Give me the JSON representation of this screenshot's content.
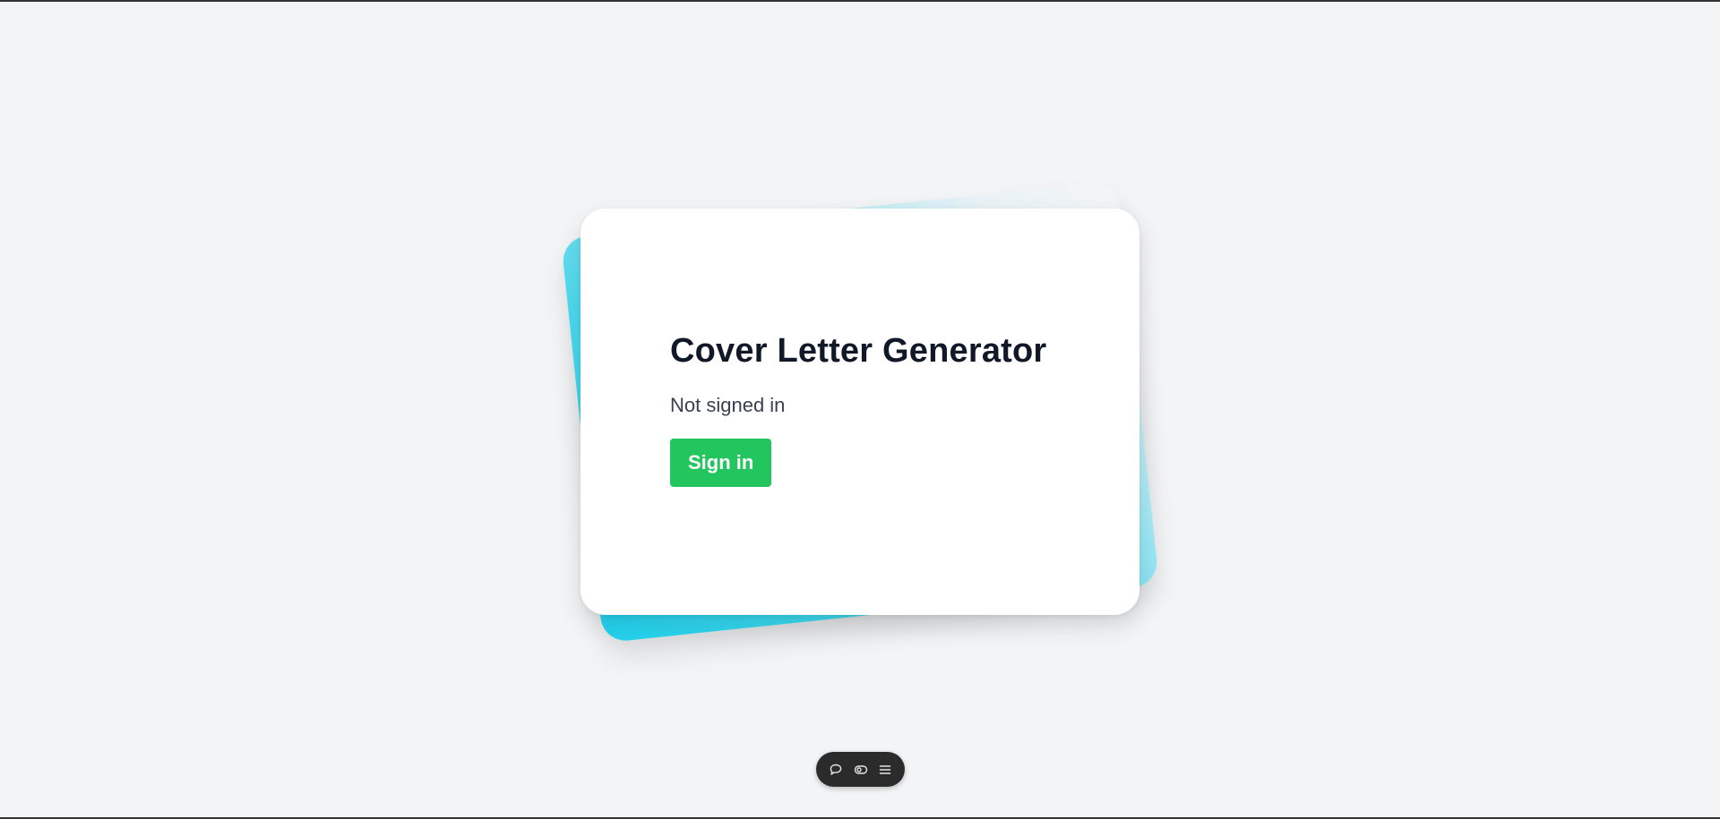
{
  "card": {
    "title": "Cover Letter Generator",
    "status": "Not signed in",
    "signin_label": "Sign in"
  },
  "toolbar": {
    "icons": [
      "chat-bubble-icon",
      "eye-toggle-icon",
      "menu-icon"
    ]
  },
  "colors": {
    "background": "#f3f4f6",
    "accent_back": "#22d3ee",
    "signin_button": "#22c55e",
    "title_text": "#111827",
    "toolbar_bg": "#2b2b2b"
  }
}
